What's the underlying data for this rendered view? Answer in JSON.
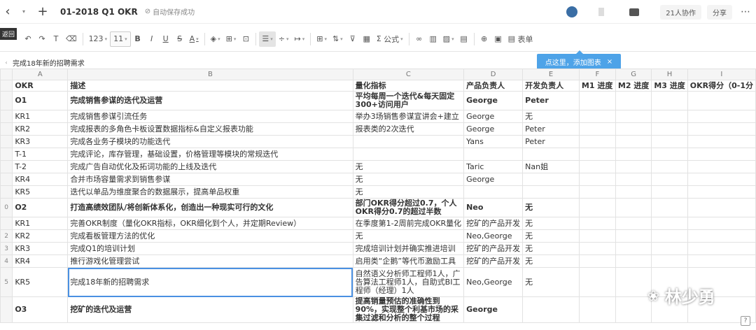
{
  "topbar": {
    "doc_title": "01-2018 Q1 OKR",
    "save_status": "自动保存成功",
    "collab": "21人协作",
    "share": "分享",
    "back_tooltip": "返回"
  },
  "toolbar": {
    "zoom": "123",
    "font_size": "11",
    "formula": "公式",
    "form": "表单"
  },
  "chart_tip": {
    "text": "点这里，添加图表",
    "close": "×"
  },
  "formula_bar": {
    "value": "完成18年新的招聘需求"
  },
  "columns": [
    "A",
    "B",
    "C",
    "D",
    "E",
    "F",
    "G",
    "H",
    "I"
  ],
  "rows": [
    {
      "rh": "",
      "cells": [
        "OKR",
        "描述",
        "量化指标",
        "产品负责人",
        "开发负责人",
        "M1 进度",
        "M2 进度",
        "M3 进度",
        "OKR得分（0-1分"
      ]
    },
    {
      "rh": "",
      "cells": [
        "O1",
        "完成销售参谋的迭代及运营",
        "平均每周一个迭代&每天固定300+访问用户",
        "George",
        "Peter",
        "",
        "",
        "",
        ""
      ]
    },
    {
      "rh": "",
      "cells": [
        "KR1",
        "完成销售参谋引流任务",
        "举办3场销售参谋宣讲会+建立",
        "George",
        "无",
        "",
        "",
        "",
        ""
      ]
    },
    {
      "rh": "",
      "cells": [
        "KR2",
        "完成报表的多角色卡板设置数据指标&自定义报表功能",
        "报表类的2次迭代",
        "George",
        "Peter",
        "",
        "",
        "",
        ""
      ]
    },
    {
      "rh": "",
      "cells": [
        "KR3",
        "完成各业务子模块的功能迭代",
        "",
        "Yans",
        "Peter",
        "",
        "",
        "",
        ""
      ]
    },
    {
      "rh": "",
      "cells": [
        "T-1",
        "完成评论，库存管理，基础设置，价格管理等模块的常规迭代",
        "",
        "",
        "",
        "",
        "",
        "",
        ""
      ]
    },
    {
      "rh": "",
      "cells": [
        "T-2",
        "完成广告自动优化及拓词功能的上线及迭代",
        "无",
        "Taric",
        "Nan姐",
        "",
        "",
        "",
        ""
      ]
    },
    {
      "rh": "",
      "cells": [
        "KR4",
        "合并市场容量需求到销售参谋",
        "无",
        "George",
        "",
        "",
        "",
        "",
        ""
      ]
    },
    {
      "rh": "",
      "cells": [
        "KR5",
        "迭代以单品为维度聚合的数据展示，提高单品权重",
        "无",
        "",
        "",
        "",
        "",
        "",
        ""
      ]
    },
    {
      "rh": "0",
      "cells": [
        "O2",
        "打造高绩效团队/将创新体系化，创造出一种现实可行的文化",
        "部门OKR得分超过0.7，个人OKR得分0.7的超过半数",
        "Neo",
        "无",
        "",
        "",
        "",
        ""
      ]
    },
    {
      "rh": "",
      "cells": [
        "KR1",
        "完善OKR制度（量化OKR指标，OKR细化到个人，并定期Review）",
        "在季度第1-2周前完成OKR量化",
        "挖矿的产品开发",
        "无",
        "",
        "",
        "",
        ""
      ]
    },
    {
      "rh": "2",
      "cells": [
        "KR2",
        "完成看板管理方法的优化",
        "无",
        "Neo,George",
        "无",
        "",
        "",
        "",
        ""
      ]
    },
    {
      "rh": "3",
      "cells": [
        "KR3",
        "完成Q1的培训计划",
        "完成培训计划并确实推进培训",
        "挖矿的产品开发",
        "无",
        "",
        "",
        "",
        ""
      ]
    },
    {
      "rh": "4",
      "cells": [
        "KR4",
        "推行游戏化管理尝试",
        "启用类“企鹅”等代币激励工具",
        "挖矿的产品开发",
        "无",
        "",
        "",
        "",
        ""
      ]
    },
    {
      "rh": "5",
      "cells": [
        "KR5",
        "完成18年新的招聘需求",
        "自然语义分析师工程师1人，广告算法工程师1人，自助式BI工程师（经理）1人",
        "Neo,George",
        "无",
        "",
        "",
        "",
        ""
      ]
    },
    {
      "rh": "",
      "cells": [
        "O3",
        "挖矿的迭代及运营",
        "提高销量预估的准确性到90%，实现整个利基市场的采集过滤和分析的整个过程",
        "George",
        "",
        "",
        "",
        "",
        ""
      ]
    }
  ],
  "watermark": "林少勇",
  "help": "?"
}
